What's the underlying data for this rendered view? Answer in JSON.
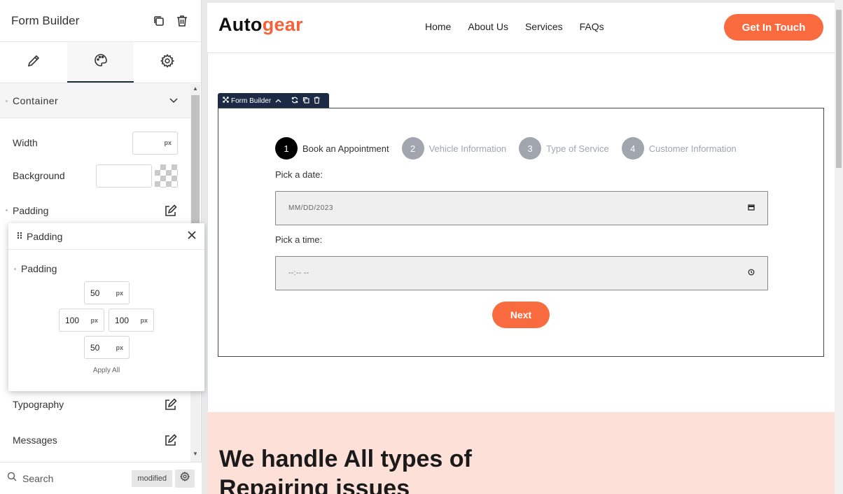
{
  "panel": {
    "title": "Form Builder",
    "tabs": [
      "content-tab",
      "style-tab",
      "advanced-tab"
    ],
    "section": {
      "label": "Container"
    },
    "rows": {
      "width_label": "Width",
      "width_unit": "px",
      "background_label": "Background",
      "padding_label": "Padding",
      "typography_label": "Typography",
      "messages_label": "Messages"
    },
    "footer": {
      "search_label": "Search",
      "modified_badge": "modified"
    }
  },
  "popup": {
    "title": "Padding",
    "field_label": "Padding",
    "top": "50",
    "left": "100",
    "right": "100",
    "bottom": "50",
    "unit": "px",
    "apply_all": "Apply All"
  },
  "site": {
    "logo_part1": "Auto",
    "logo_part2": "gear",
    "nav": [
      "Home",
      "About Us",
      "Services",
      "FAQs"
    ],
    "cta": "Get In Touch",
    "hero_title": "We handle All types of Repairing issues"
  },
  "form_builder": {
    "toolbar_label": "Form Builder",
    "steps": [
      {
        "num": "1",
        "label": "Book an Appointment"
      },
      {
        "num": "2",
        "label": "Vehicle Information"
      },
      {
        "num": "3",
        "label": "Type of Service"
      },
      {
        "num": "4",
        "label": "Customer Information"
      }
    ],
    "date_label": "Pick a date:",
    "date_value": "MM/DD/2023",
    "time_label": "Pick a time:",
    "time_value": "--:-- --",
    "next": "Next"
  },
  "colors": {
    "accent": "#f96b3e",
    "logo_accent": "#f4623a",
    "toolbar": "#1d2a45",
    "hero_bg": "#fde0d8"
  }
}
